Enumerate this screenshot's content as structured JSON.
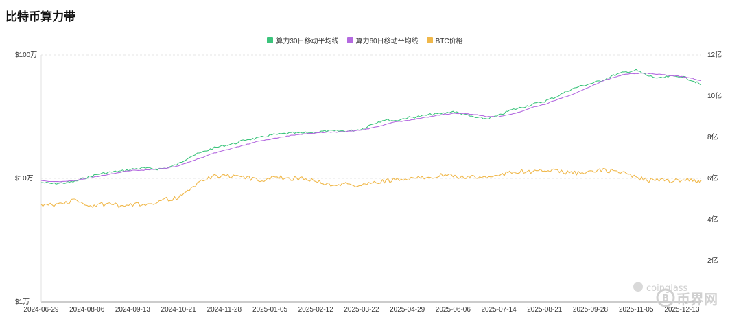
{
  "title": "比特币算力带",
  "watermark": {
    "line1": "coinglass",
    "line2": "币界网"
  },
  "chart_data": {
    "type": "line",
    "title": "比特币算力带",
    "x_dates": [
      "2024-06-29",
      "2024-07-08",
      "2024-07-18",
      "2024-07-27",
      "2024-08-06",
      "2024-08-15",
      "2024-08-25",
      "2024-09-03",
      "2024-09-13",
      "2024-09-22",
      "2024-10-02",
      "2024-10-11",
      "2024-10-21",
      "2024-10-30",
      "2024-11-09",
      "2024-11-18",
      "2024-11-28",
      "2024-12-07",
      "2024-12-17",
      "2024-12-26",
      "2025-01-05",
      "2025-01-14",
      "2025-01-24",
      "2025-02-02",
      "2025-02-12",
      "2025-02-21",
      "2025-03-03",
      "2025-03-12",
      "2025-03-22",
      "2025-03-31",
      "2025-04-10",
      "2025-04-19",
      "2025-04-29",
      "2025-05-08",
      "2025-05-18",
      "2025-05-27",
      "2025-06-06",
      "2025-06-15",
      "2025-06-25",
      "2025-07-04",
      "2025-07-14",
      "2025-07-23",
      "2025-08-02",
      "2025-08-11",
      "2025-08-21",
      "2025-08-30",
      "2025-09-09",
      "2025-09-18",
      "2025-09-28",
      "2025-10-07",
      "2025-10-17",
      "2025-10-26",
      "2025-11-05",
      "2025-11-14",
      "2025-11-24",
      "2025-12-03",
      "2025-12-13",
      "2025-12-22",
      "2025-12-29"
    ],
    "x_ticks": [
      "2024-06-29",
      "2024-08-06",
      "2024-09-13",
      "2024-10-21",
      "2024-11-28",
      "2025-01-05",
      "2025-02-12",
      "2025-03-22",
      "2025-04-29",
      "2025-06-06",
      "2025-07-14",
      "2025-08-21",
      "2025-09-28",
      "2025-11-05",
      "2025-12-13"
    ],
    "y_left": {
      "scale": "log",
      "ticks": [
        "$100万",
        "$10万",
        "$1万"
      ],
      "tick_values": [
        1000000,
        100000,
        10000
      ],
      "range": [
        10000,
        1000000
      ]
    },
    "y_right": {
      "scale": "linear",
      "ticks": [
        "12亿",
        "10亿",
        "8亿",
        "6亿",
        "4亿",
        "2亿"
      ],
      "tick_values": [
        12,
        10,
        8,
        6,
        4,
        2
      ],
      "range": [
        0,
        12
      ]
    },
    "series": [
      {
        "name": "算力30日移动平均线",
        "axis": "right",
        "color": "#3cc47c",
        "values": [
          5.8,
          5.75,
          5.78,
          5.85,
          6.05,
          6.2,
          6.3,
          6.35,
          6.45,
          6.5,
          6.45,
          6.5,
          6.7,
          7.05,
          7.25,
          7.45,
          7.6,
          7.7,
          7.9,
          7.95,
          8.1,
          8.15,
          8.2,
          8.2,
          8.25,
          8.3,
          8.3,
          8.3,
          8.4,
          8.65,
          8.85,
          8.8,
          8.95,
          9.0,
          9.1,
          9.15,
          9.25,
          9.1,
          8.95,
          8.9,
          9.05,
          9.3,
          9.45,
          9.6,
          9.75,
          9.95,
          10.25,
          10.45,
          10.6,
          10.75,
          11.0,
          11.15,
          11.25,
          11.0,
          10.85,
          10.95,
          10.95,
          10.75,
          10.55
        ]
      },
      {
        "name": "算力60日移动平均线",
        "axis": "right",
        "color": "#b46ae0",
        "values": [
          5.9,
          5.85,
          5.85,
          5.9,
          6.0,
          6.1,
          6.2,
          6.3,
          6.4,
          6.4,
          6.45,
          6.5,
          6.6,
          6.8,
          7.0,
          7.2,
          7.35,
          7.5,
          7.65,
          7.8,
          7.9,
          8.0,
          8.1,
          8.15,
          8.2,
          8.25,
          8.25,
          8.3,
          8.35,
          8.45,
          8.6,
          8.75,
          8.8,
          8.9,
          9.0,
          9.1,
          9.15,
          9.15,
          9.1,
          9.0,
          9.0,
          9.1,
          9.25,
          9.45,
          9.6,
          9.8,
          10.0,
          10.2,
          10.45,
          10.7,
          10.9,
          11.05,
          11.1,
          11.1,
          11.05,
          11.0,
          10.95,
          10.85,
          10.75
        ]
      },
      {
        "name": "BTC价格",
        "axis": "right",
        "color": "#f0b84a",
        "values": [
          4.75,
          4.7,
          4.8,
          4.95,
          4.65,
          4.7,
          4.8,
          4.6,
          4.7,
          4.75,
          4.85,
          5.0,
          5.05,
          5.4,
          5.9,
          6.1,
          6.1,
          6.15,
          6.05,
          5.9,
          6.0,
          6.05,
          6.0,
          6.0,
          5.9,
          5.7,
          5.75,
          5.7,
          5.65,
          5.8,
          5.85,
          5.95,
          5.9,
          6.05,
          6.1,
          6.15,
          6.1,
          6.05,
          6.05,
          6.1,
          6.15,
          6.3,
          6.35,
          6.3,
          6.4,
          6.35,
          6.3,
          6.25,
          6.3,
          6.4,
          6.35,
          6.25,
          6.05,
          5.9,
          5.95,
          5.85,
          5.95,
          5.9,
          5.9
        ]
      }
    ],
    "legend_position": "top-center",
    "grid": true
  }
}
